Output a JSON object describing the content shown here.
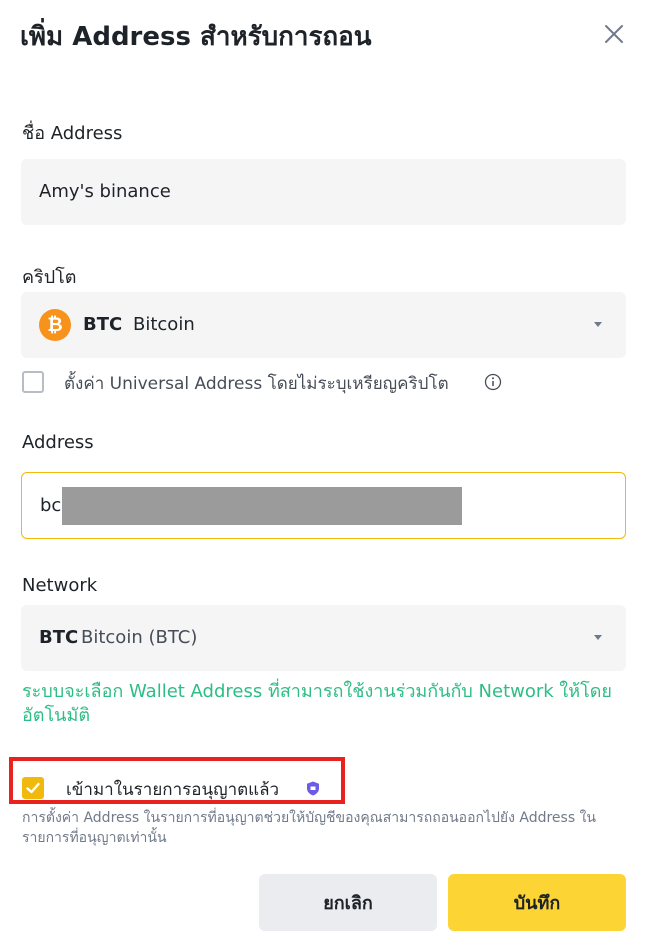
{
  "dialog": {
    "title": "เพิ่ม Address สำหรับการถอน"
  },
  "address_name": {
    "label": "ชื่อ Address",
    "value": "Amy's binance"
  },
  "crypto": {
    "label": "คริปโต",
    "coin_symbol": "BTC",
    "coin_name": "Bitcoin",
    "coin_icon": "bitcoin-icon",
    "coin_icon_glyph": "₿",
    "coin_color": "#f7931a"
  },
  "universal": {
    "label": "ตั้งค่า Universal Address โดยไม่ระบุเหรียญคริปโต",
    "checked": false
  },
  "address": {
    "label": "Address",
    "value_visible": "bc"
  },
  "network": {
    "label": "Network",
    "symbol": "BTC",
    "name": "Bitcoin (BTC)",
    "hint": "ระบบจะเลือก Wallet Address ที่สามารถใช้งานร่วมกันกับ Network ให้โดยอัตโนมัติ"
  },
  "whitelist": {
    "label": "เข้ามาในรายการอนุญาตแล้ว",
    "checked": true,
    "note": "การตั้งค่า Address ในรายการที่อนุญาตช่วยให้บัญชีของคุณสามารถถอนออกไปยัง Address ในรายการที่อนุญาตเท่านั้น"
  },
  "actions": {
    "cancel_label": "ยกเลิก",
    "save_label": "บันทึก"
  },
  "colors": {
    "accent": "#f0b90b",
    "button_primary": "#fcd535",
    "hint_green": "#2ebd85",
    "highlight_red": "#e8231f"
  }
}
